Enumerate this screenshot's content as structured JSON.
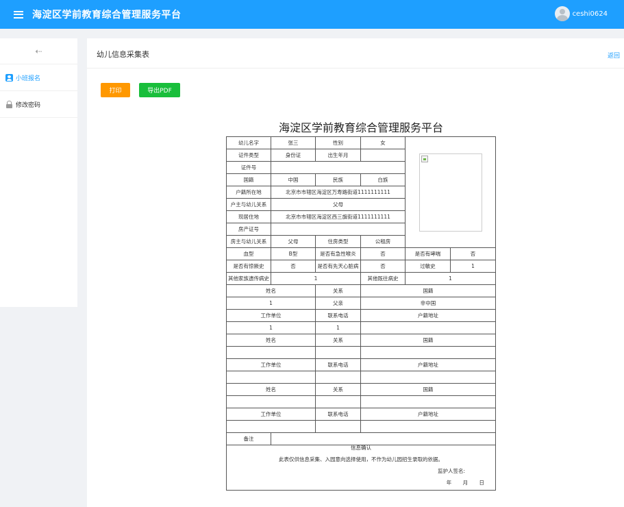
{
  "header": {
    "title": "海淀区学前教育综合管理服务平台",
    "username": "ceshi0624"
  },
  "sidebar": {
    "items": [
      {
        "label": "小班报名",
        "icon": "user-icon"
      },
      {
        "label": "修改密码",
        "icon": "lock-icon"
      }
    ]
  },
  "page": {
    "title": "幼儿信息采集表",
    "back": "返回"
  },
  "buttons": {
    "print": "打印",
    "export_pdf": "导出PDF"
  },
  "form": {
    "title": "海淀区学前教育综合管理服务平台",
    "child_name_label": "幼儿名字",
    "child_name": "张三",
    "gender_label": "性别",
    "gender": "女",
    "id_type_label": "证件类型",
    "id_type": "身份证",
    "birth_label": "出生年月",
    "birth": "",
    "id_no_label": "证件号",
    "id_no": "",
    "nationality_label": "国籍",
    "nationality": "中国",
    "ethnicity_label": "民族",
    "ethnicity": "白族",
    "household_addr_label": "户籍所在地",
    "household_addr": "北京市市辖区海淀区万寿路街道1111111111",
    "householder_rel_label": "户主与幼儿关系",
    "householder_rel": "父母",
    "current_addr_label": "现居住地",
    "current_addr": "北京市市辖区海淀区西三旗街道1111111111",
    "property_no_label": "房产证号",
    "property_no": "",
    "owner_rel_label": "房主与幼儿关系",
    "owner_rel": "父母",
    "housing_type_label": "住房类型",
    "housing_type": "公租房",
    "blood_label": "血型",
    "blood": "B型",
    "acute_label": "是否有急性喉炎",
    "acute": "否",
    "asthma_label": "是否有哮喘",
    "asthma": "否",
    "convulsion_label": "是否有惊厥史",
    "convulsion": "否",
    "heart_label": "是否有先天心脏病",
    "heart": "否",
    "allergy_label": "过敏史",
    "allergy": "1",
    "family_disease_label": "其他家族遗传病史",
    "family_disease": "1",
    "other_disease_label": "其他既往病史",
    "other_disease": "1",
    "name_h": "姓名",
    "relation_h": "关系",
    "nationality_h": "国籍",
    "work_h": "工作单位",
    "phone_h": "联系电话",
    "household_h": "户籍地址",
    "guardians": [
      {
        "name": "1",
        "relation": "父亲",
        "nationality": "非中国",
        "work": "1",
        "phone": "1",
        "household": ""
      },
      {
        "name": "",
        "relation": "",
        "nationality": "",
        "work": "",
        "phone": "",
        "household": ""
      },
      {
        "name": "",
        "relation": "",
        "nationality": "",
        "work": "",
        "phone": "",
        "household": ""
      }
    ],
    "remark_label": "备注",
    "remark": "",
    "confirm_title": "信息确认",
    "confirm_text": "此表仅供信息采集、入园意向选择使用，不作为幼儿园招生录取的依据。",
    "signature": "监护人签名:",
    "date": "年 月 日"
  }
}
